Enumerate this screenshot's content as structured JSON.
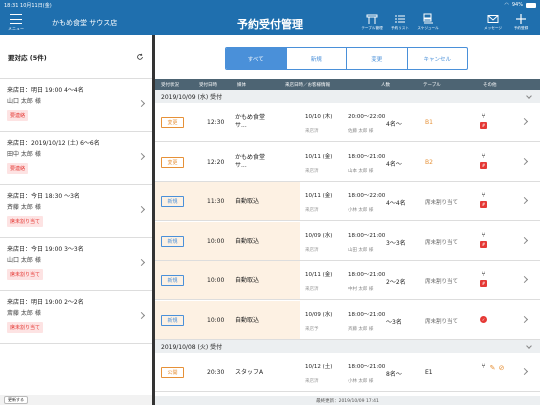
{
  "status": {
    "time": "18:31",
    "date": "10月11日(金)",
    "battery": "94%",
    "battery_level": 0.94
  },
  "header": {
    "menu_label": "メニュー",
    "shop_name": "かもめ食堂 サウス店",
    "title": "予約受付管理",
    "icons": [
      {
        "icon": "table-icon",
        "label": "テーブル管理"
      },
      {
        "icon": "list-icon",
        "label": "予約リスト"
      },
      {
        "icon": "schedule-icon",
        "label": "スケジュール"
      },
      {
        "icon": "mail-icon",
        "label": "メッセージ"
      },
      {
        "icon": "plus-icon",
        "label": "予約登録"
      }
    ]
  },
  "left": {
    "heading": "要対応 (5件)",
    "cards": [
      {
        "line1": "来店日：明日 19:00 4〜4名",
        "line2": "山口 太郎 様",
        "badge": "要連絡"
      },
      {
        "line1": "来店日：2019/10/12 (土) 6〜6名",
        "line2": "田中 太郎 様",
        "badge": "要連絡"
      },
      {
        "line1": "来店日：今日 18:30 〜3名",
        "line2": "斉藤 太郎 様",
        "badge": "席未割り当て"
      },
      {
        "line1": "来店日：今日 19:00 3〜3名",
        "line2": "山口 太郎 様",
        "badge": "席未割り当て"
      },
      {
        "line1": "来店日：明日 19:00 2〜2名",
        "line2": "斎藤 太郎 様",
        "badge": "席未割り当て"
      }
    ],
    "footer_button": "更新する"
  },
  "tabs": [
    "すべて",
    "新規",
    "変更",
    "キャンセル"
  ],
  "columns": [
    "受付状況",
    "受付日時",
    "媒体",
    "来店日時／お客様情報",
    "人数",
    "テーブル",
    "その他"
  ],
  "groups": [
    {
      "date": "2019/10/09 (水) 受付",
      "rows": [
        {
          "status": "変更",
          "status_type": "change",
          "time": "12:30",
          "media": "かもめ食堂 サ...",
          "date": "10/10 (木)",
          "sub": "来店済",
          "range": "20:00〜22:00",
          "name": "佐藤 太郎 様",
          "people": "4名〜",
          "table": "B1",
          "table_style": "orange",
          "icons": [
            "fork-icon",
            "hashtag-icon"
          ]
        },
        {
          "status": "変更",
          "status_type": "change",
          "time": "12:20",
          "media": "かもめ食堂 サ...",
          "date": "10/11 (金)",
          "sub": "来店済",
          "range": "18:00〜21:00",
          "name": "山本 太郎 様",
          "people": "4名〜",
          "table": "B2",
          "table_style": "orange",
          "icons": [
            "fork-icon",
            "hashtag-icon"
          ]
        },
        {
          "status": "新規",
          "status_type": "new",
          "time": "11:30",
          "media": "自動取込",
          "date": "10/11 (金)",
          "sub": "来店済",
          "range": "18:00〜22:00",
          "name": "小林 太郎 様",
          "people": "4〜4名",
          "table": "席未割り当て",
          "table_style": "muted",
          "icons": [
            "fork-icon",
            "hashtag-icon"
          ]
        },
        {
          "status": "新規",
          "status_type": "new",
          "time": "10:00",
          "media": "自動取込",
          "date": "10/09 (水)",
          "sub": "来店済",
          "range": "18:00〜21:00",
          "name": "山田 太郎 様",
          "people": "3〜3名",
          "table": "席未割り当て",
          "table_style": "muted",
          "icons": [
            "fork-icon",
            "hashtag-icon"
          ]
        },
        {
          "status": "新規",
          "status_type": "new",
          "time": "10:00",
          "media": "自動取込",
          "date": "10/11 (金)",
          "sub": "来店済",
          "range": "18:00〜21:00",
          "name": "中村 太郎 様",
          "people": "2〜2名",
          "table": "席未割り当て",
          "table_style": "muted",
          "icons": [
            "fork-icon",
            "hashtag-icon"
          ]
        },
        {
          "status": "新規",
          "status_type": "new",
          "time": "10:00",
          "media": "自動取込",
          "date": "10/09 (水)",
          "sub": "来店予",
          "range": "18:00〜21:00",
          "name": "斉藤 太郎 様",
          "people": "〜3名",
          "table": "席未割り当て",
          "table_style": "muted",
          "icons": [
            "ok-icon"
          ]
        }
      ]
    },
    {
      "date": "2019/10/08 (火) 受付",
      "rows": [
        {
          "status": "公開",
          "status_type": "public",
          "time": "20:30",
          "media": "スタッフA",
          "date": "10/12 (土)",
          "sub": "来店済",
          "range": "18:00〜21:00",
          "name": "小林 太郎 様",
          "people": "8名〜",
          "table": "E1",
          "table_style": "normal",
          "icons": [
            "fork-icon",
            "memo-icon",
            "no-smoking-icon"
          ]
        }
      ]
    }
  ],
  "footer": {
    "updated": "最終更新：2019/10/09 17:41"
  }
}
